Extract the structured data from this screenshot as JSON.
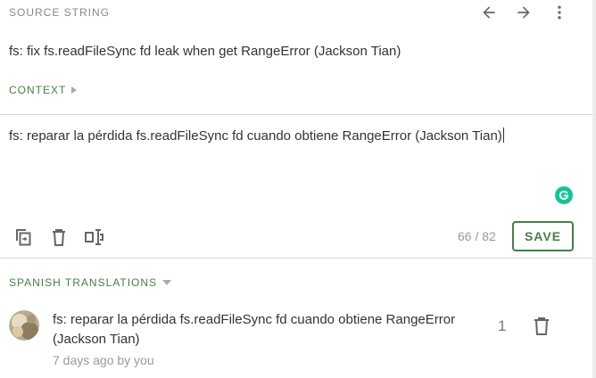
{
  "source": {
    "section_label": "SOURCE STRING",
    "text": "fs: fix fs.readFileSync fd leak when get RangeError (Jackson Tian)",
    "context_label": "CONTEXT"
  },
  "header_icons": [
    "arrow-left-icon",
    "arrow-right-icon",
    "more-vert-icon"
  ],
  "editor": {
    "value": "fs: reparar la pérdida fs.readFileSync fd cuando obtiene RangeError (Jackson Tian)",
    "char_count": "66 / 82",
    "save_label": "SAVE",
    "toolbar_icons": [
      "copy-source-icon",
      "delete-icon",
      "split-text-icon"
    ]
  },
  "translations": {
    "section_label": "SPANISH TRANSLATIONS",
    "items": [
      {
        "text": "fs: reparar la pérdida fs.readFileSync fd cuando obtiene RangeError (Jackson Tian)",
        "meta": "7 days ago by you",
        "votes": "1"
      }
    ]
  },
  "colors": {
    "accent": "#4a7c4a",
    "muted": "#999999",
    "grammarly": "#15c39a"
  }
}
